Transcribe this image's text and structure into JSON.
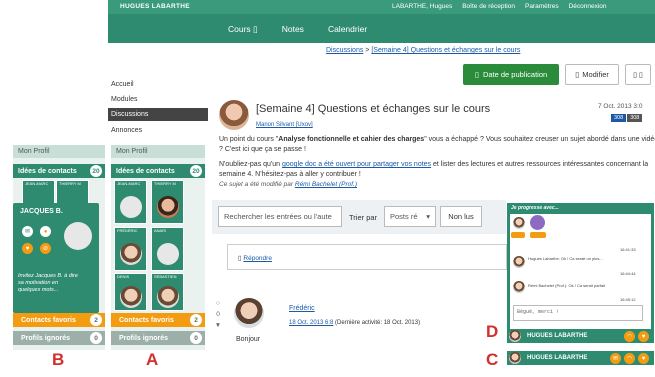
{
  "header": {
    "site_name": "HUGUES LABARTHE",
    "user": "LABARTHE, Hugues",
    "inbox": "Boîte de réception",
    "settings": "Paramètres",
    "logout": "Déconnexion"
  },
  "nav": {
    "cours": "Cours ▯",
    "notes": "Notes",
    "calendrier": "Calendrier"
  },
  "breadcrumb": {
    "root": "Discussions",
    "sep": " > ",
    "current": "[Semaine 4] Questions et échanges sur le cours"
  },
  "toolbar": {
    "publish": "Date de publication",
    "modify": "Modifier"
  },
  "course_menu": [
    "Accueil",
    "Modules",
    "Discussions",
    "Annonces"
  ],
  "post": {
    "title": "[Semaine 4] Questions et échanges sur le cours",
    "author": "Manon Silvant [Uxov]",
    "date": "7 Oct. 2013 3:0",
    "tags": [
      "308",
      "308"
    ],
    "p1_a": "Un point du cours \"",
    "p1_b": "Analyse fonctionnelle et cahier des charges",
    "p1_c": "\" vous a échappé ? Vous souhaitez creuser un sujet abordé dans une vidéo ? C'est ici que ça se passe !",
    "p2_a": "N'oubliez-pas qu'un ",
    "p2_link": "google doc a été ouvert pour partager vos notes",
    "p2_b": " et lister des lectures et autres ressources intéressantes concernant la  semaine 4. N'hésitez-pas à aller y contribuer !",
    "edited": "Ce sujet a été modifié par ",
    "edited_by": "Rémi Bachelet (Prof.)"
  },
  "filter": {
    "search_placeholder": "Rechercher les entrées ou l'aute",
    "sort_label": "Trier par",
    "sort_value": "Posts ré",
    "unread": "Non lus"
  },
  "reply": "Répondre",
  "comment": {
    "vote_up": "○",
    "score": "0",
    "vote_down": "▼",
    "author": "Frédéric",
    "date": "18 Oct. 2013 6:8",
    "meta": " (Dernière activité: 18 Oct. 2013)",
    "text": "Bonjour"
  },
  "panel_b": {
    "profile": "Mon Profil",
    "ideas": "Idées de contacts",
    "ideas_count": "20",
    "tile1": "JEAN-MARC",
    "tile2": "THIERRY M",
    "card_name": "JACQUES B.",
    "card_text": "Invitez Jacques B. à dire sa motivation en quelques mots...",
    "favorites": "Contacts favoris",
    "favorites_count": "2",
    "ignored": "Profils ignorés",
    "ignored_count": "0",
    "letter": "B"
  },
  "panel_a": {
    "profile": "Mon Profil",
    "ideas": "Idées de contacts",
    "ideas_count": "20",
    "tiles": [
      "JEAN-MARC",
      "THIERRY M",
      "FRÉDÉRIC",
      "ANAÏS",
      "DENIS",
      "SÉBASTIEN"
    ],
    "favorites": "Contacts favoris",
    "favorites_count": "2",
    "ignored": "Profils ignorés",
    "ignored_count": "0",
    "letter": "A"
  },
  "chat": {
    "title": "Je progresse avec...",
    "msg1": "Hugues Labarthe: Ok ! Ca serait un plus...",
    "time1": "16:41:33",
    "msg2": "Rémi Bachelet (Prof.): Ok ! Ca serait parfait",
    "time2": "16:44:44",
    "time3": "16:45:12",
    "input": "Bégué, merci !",
    "footer_d": "HUGUES LABARTHE",
    "footer_c": "HUGUES LABARTHE",
    "letter_d": "D",
    "letter_c": "C"
  }
}
